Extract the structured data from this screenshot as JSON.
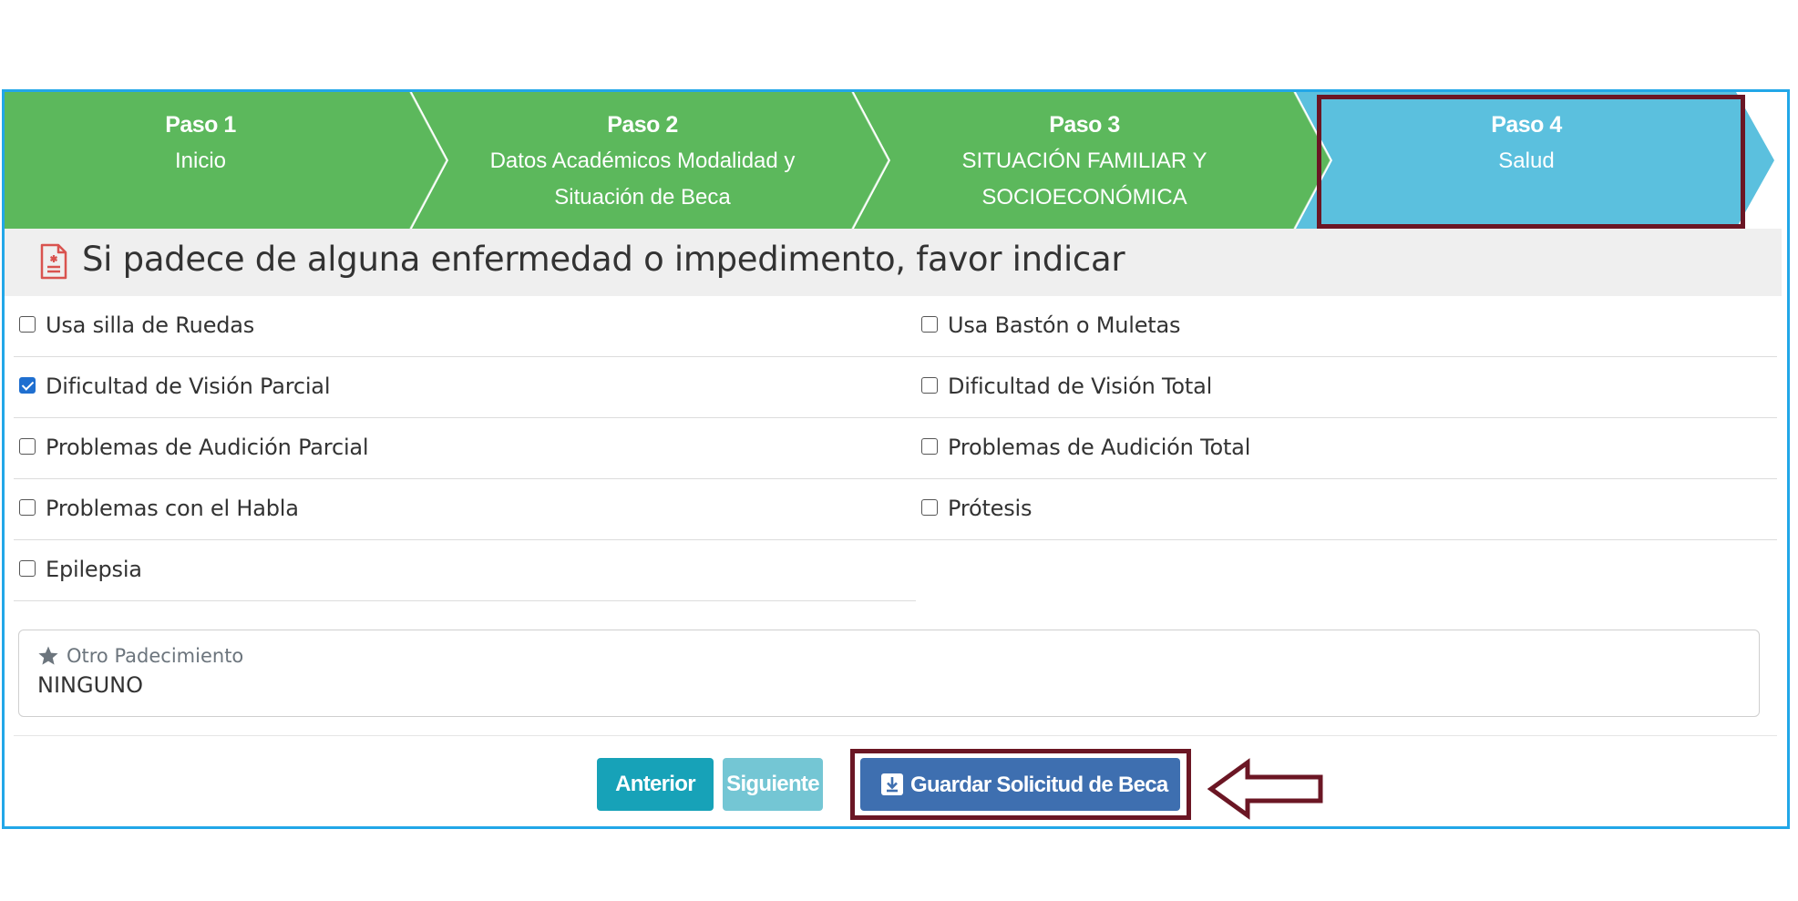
{
  "wizard": {
    "steps": [
      {
        "title": "Paso 1",
        "lines": [
          "Inicio"
        ],
        "state": "completed"
      },
      {
        "title": "Paso 2",
        "lines": [
          "Datos Académicos Modalidad y",
          "Situación de Beca"
        ],
        "state": "completed"
      },
      {
        "title": "Paso 3",
        "lines": [
          "SITUACIÓN FAMILIAR Y",
          "SOCIOECONÓMICA"
        ],
        "state": "completed"
      },
      {
        "title": "Paso 4",
        "lines": [
          "Salud"
        ],
        "state": "active"
      }
    ],
    "colors": {
      "completed": "#5cb85c",
      "active": "#5bc0de"
    }
  },
  "section": {
    "icon": "medical-document-icon",
    "title": "Si padece de alguna enfermedad o impedimento, favor indicar"
  },
  "conditions": [
    {
      "label": "Usa silla de Ruedas",
      "checked": false
    },
    {
      "label": "Usa Bastón o Muletas",
      "checked": false
    },
    {
      "label": "Dificultad de Visión Parcial",
      "checked": true
    },
    {
      "label": "Dificultad de Visión Total",
      "checked": false
    },
    {
      "label": "Problemas de Audición Parcial",
      "checked": false
    },
    {
      "label": "Problemas de Audición Total",
      "checked": false
    },
    {
      "label": "Problemas con el Habla",
      "checked": false
    },
    {
      "label": "Prótesis",
      "checked": false
    },
    {
      "label": "Epilepsia",
      "checked": false
    }
  ],
  "other": {
    "icon": "star-icon",
    "label": "Otro Padecimiento",
    "value": "NINGUNO"
  },
  "buttons": {
    "previous": "Anterior",
    "next": "Siguiente",
    "save": "Guardar Solicitud de Beca",
    "save_icon": "download-icon"
  },
  "annotation_color": "#6b1624"
}
